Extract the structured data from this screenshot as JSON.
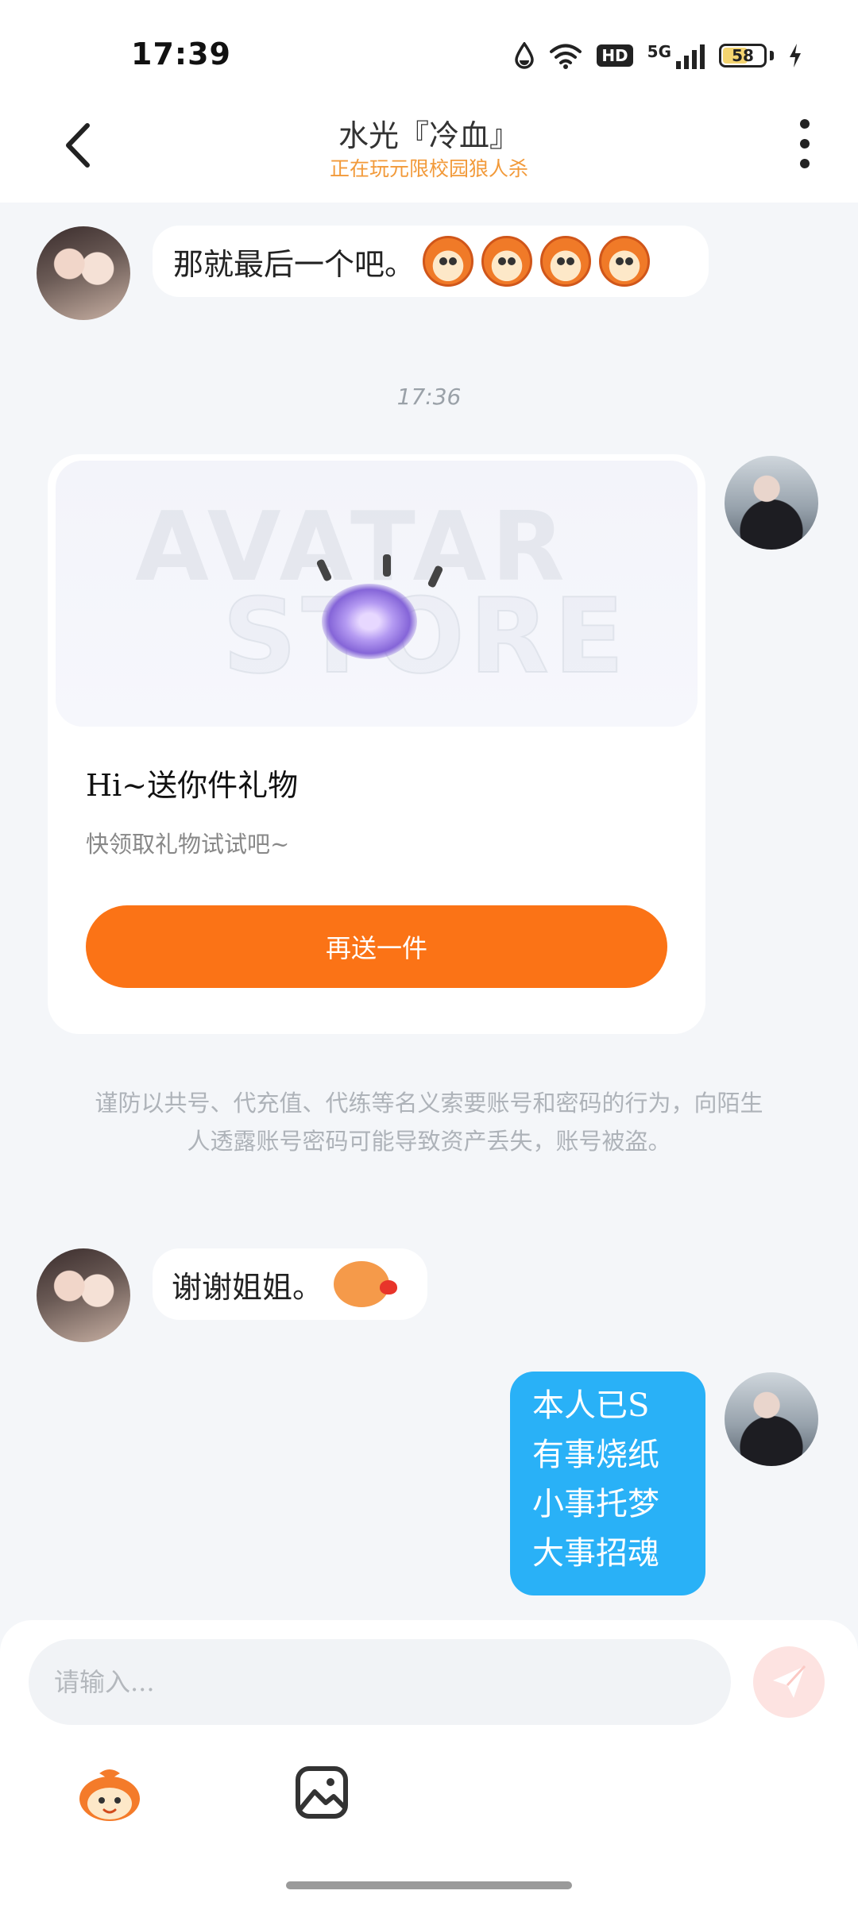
{
  "status_bar": {
    "time": "17:39",
    "network": "5G",
    "hd": "HD",
    "battery": "58",
    "icons": [
      "water-drop-icon",
      "wifi-icon",
      "hd-icon",
      "signal-icon",
      "battery-icon",
      "charging-icon"
    ]
  },
  "header": {
    "title": "水光『冷血』",
    "subtitle": "正在玩元限校园狼人杀"
  },
  "messages": {
    "m1_text": "那就最后一个吧。",
    "timestamp": "17:36",
    "gift": {
      "watermark_line1": "AVATAR",
      "watermark_line2": "STORE",
      "title": "Hi~送你件礼物",
      "desc": "快领取礼物试试吧~",
      "button": "再送一件"
    },
    "warning": "谨防以共号、代充值、代练等名义索要账号和密码的行为，向陌生人透露账号密码可能导致资产丢失，账号被盗。",
    "m2_text": "谢谢姐姐。",
    "blue_lines": [
      "本人已S",
      "有事烧纸",
      "小事托梦",
      "大事招魂"
    ]
  },
  "input": {
    "placeholder": "请输入..."
  },
  "colors": {
    "accent_orange": "#fb7316",
    "bubble_blue": "#29b1f7",
    "subtitle_orange": "#f29a3a",
    "send_pink": "#fde3e1"
  }
}
